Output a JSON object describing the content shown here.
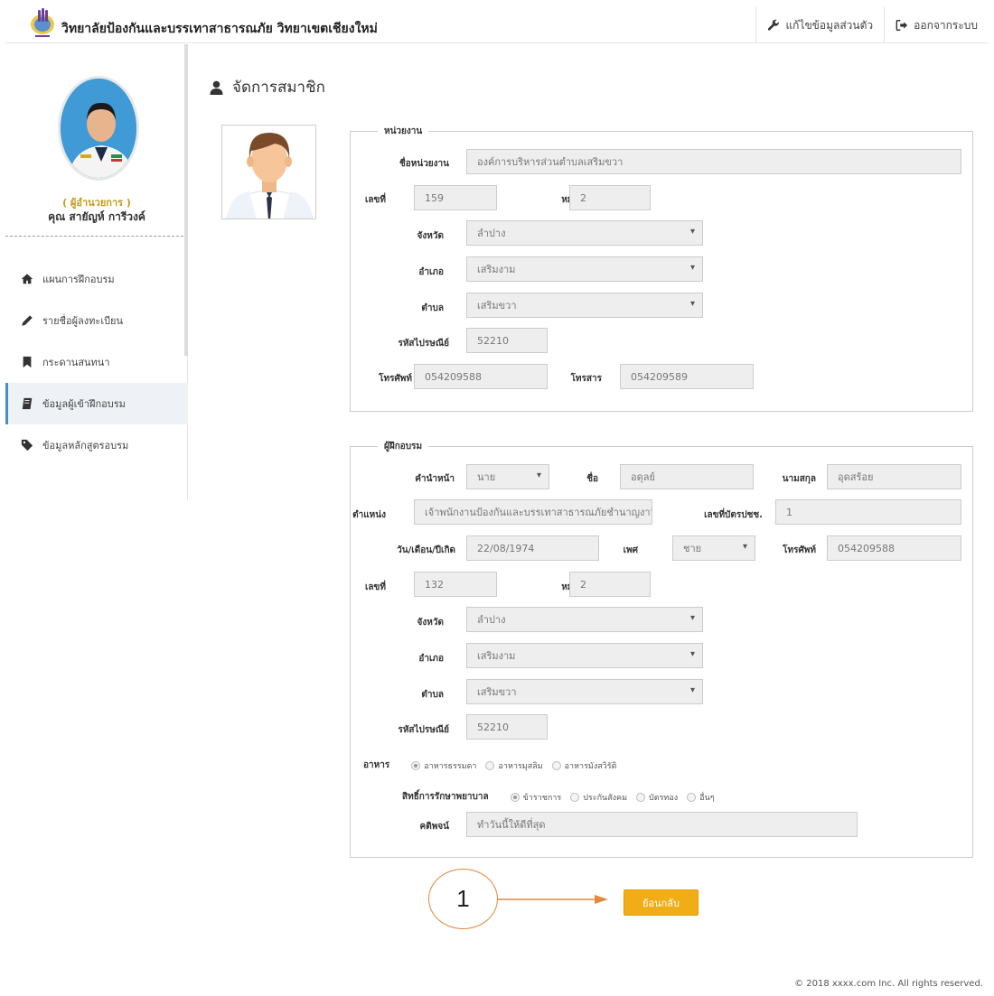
{
  "header": {
    "title": "วิทยาลัยป้องกันและบรรเทาสาธารณภัย วิทยาเขตเชียงใหม่",
    "edit_profile": "แก้ไขข้อมูลส่วนตัว",
    "logout": "ออกจากระบบ"
  },
  "sidebar": {
    "role": "( ผู้อำนวยการ )",
    "name": "คุณ สายัญห์ การีวงค์",
    "items": [
      {
        "label": "แผนการฝึกอบรม",
        "icon": "home-icon"
      },
      {
        "label": "รายชื่อผู้ลงทะเบียน",
        "icon": "pencil-icon"
      },
      {
        "label": "กระดานสนทนา",
        "icon": "bookmark-icon"
      },
      {
        "label": "ข้อมูลผู้เข้าฝึกอบรม",
        "icon": "book-icon",
        "active": true
      },
      {
        "label": "ข้อมูลหลักสูตรอบรม",
        "icon": "tag-icon"
      }
    ]
  },
  "page": {
    "title": "จัดการสมาชิก"
  },
  "agency": {
    "legend": "หน่วยงาน",
    "name_label": "ชื่อหน่วยงาน",
    "name_value": "องค์การบริหารส่วนตำบลเสริมขวา",
    "house_no_label": "เลขที่",
    "house_no_value": "159",
    "moo_label": "หมู่ที่",
    "moo_value": "2",
    "province_label": "จังหวัด",
    "province_value": "ลำปาง",
    "district_label": "อำเภอ",
    "district_value": "เสริมงาม",
    "subdistrict_label": "ตำบล",
    "subdistrict_value": "เสริมขวา",
    "postcode_label": "รหัสไปรษณีย์",
    "postcode_value": "52210",
    "phone_label": "โทรศัพท์",
    "phone_value": "054209588",
    "fax_label": "โทรสาร",
    "fax_value": "054209589"
  },
  "trainee": {
    "legend": "ผู้ฝึกอบรม",
    "prefix_label": "คำนำหน้า",
    "prefix_value": "นาย",
    "firstname_label": "ชื่อ",
    "firstname_value": "อดุลย์",
    "lastname_label": "นามสกุล",
    "lastname_value": "อุดสร้อย",
    "position_label": "ตำแหน่ง",
    "position_value": "เจ้าพนักงานป้องกันและบรรเทาสาธารณภัยชำนาญงา'",
    "idcard_label": "เลขที่บัตรปชช.",
    "idcard_value": "1",
    "dob_label": "วัน/เดือน/ปีเกิด",
    "dob_value": "22/08/1974",
    "gender_label": "เพศ",
    "gender_value": "ชาย",
    "phone_label": "โทรศัพท์",
    "phone_value": "054209588",
    "house_no_label": "เลขที่",
    "house_no_value": "132",
    "moo_label": "หมู่ที่",
    "moo_value": "2",
    "province_label": "จังหวัด",
    "province_value": "ลำปาง",
    "district_label": "อำเภอ",
    "district_value": "เสริมงาม",
    "subdistrict_label": "ตำบล",
    "subdistrict_value": "เสริมขวา",
    "postcode_label": "รหัสไปรษณีย์",
    "postcode_value": "52210",
    "food_label": "อาหาร",
    "food_options": [
      "อาหารธรรมดา",
      "อาหารมุสลิม",
      "อาหารมังสวิรัติ"
    ],
    "medical_label": "สิทธิ์การรักษาพยาบาล",
    "medical_options": [
      "ข้าราชการ",
      "ประกันสังคม",
      "บัตรทอง",
      "อื่นๆ"
    ],
    "motto_label": "คติพจน์",
    "motto_value": "ทำวันนี้ให้ดีที่สุด"
  },
  "actions": {
    "back": "ย้อนกลับ"
  },
  "annotation": {
    "number": "1"
  },
  "footer": {
    "copyright": "© 2018 xxxx.com Inc. All rights reserved."
  },
  "colors": {
    "accent": "#f0ad15",
    "active_border": "#4a90c8",
    "annotation": "#e3883c",
    "role": "#c59a1c"
  }
}
